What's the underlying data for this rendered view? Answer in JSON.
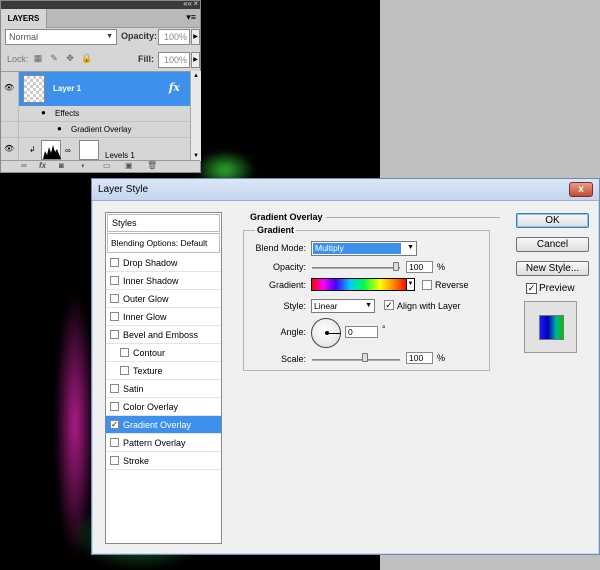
{
  "layers_panel": {
    "tab": "LAYERS",
    "menu_icon": "panel-menu-icon",
    "blend_mode": "Normal",
    "opacity_label": "Opacity:",
    "opacity_value": "100%",
    "lock_label": "Lock:",
    "fill_label": "Fill:",
    "fill_value": "100%",
    "layers": [
      {
        "name": "Layer 1",
        "fx": "fx"
      },
      {
        "name": "Levels 1"
      }
    ],
    "effects_label": "Effects",
    "effect_item": "Gradient Overlay"
  },
  "dialog": {
    "title": "Layer Style",
    "close": "x",
    "styles_header": "Styles",
    "blending_options": "Blending Options: Default",
    "style_items": [
      {
        "label": "Drop Shadow",
        "checked": false
      },
      {
        "label": "Inner Shadow",
        "checked": false
      },
      {
        "label": "Outer Glow",
        "checked": false
      },
      {
        "label": "Inner Glow",
        "checked": false
      },
      {
        "label": "Bevel and Emboss",
        "checked": false
      },
      {
        "label": "Contour",
        "checked": false,
        "indent": true
      },
      {
        "label": "Texture",
        "checked": false,
        "indent": true
      },
      {
        "label": "Satin",
        "checked": false
      },
      {
        "label": "Color Overlay",
        "checked": false
      },
      {
        "label": "Gradient Overlay",
        "checked": true,
        "selected": true
      },
      {
        "label": "Pattern Overlay",
        "checked": false
      },
      {
        "label": "Stroke",
        "checked": false
      }
    ],
    "section_title": "Gradient Overlay",
    "group_title": "Gradient",
    "blend_mode_label": "Blend Mode:",
    "blend_mode_value": "Multiply",
    "opacity_label": "Opacity:",
    "opacity_value": "100",
    "opacity_unit": "%",
    "gradient_label": "Gradient:",
    "reverse_label": "Reverse",
    "style_label": "Style:",
    "style_value": "Linear",
    "align_label": "Align with Layer",
    "align_checked": true,
    "angle_label": "Angle:",
    "angle_value": "0",
    "angle_unit": "°",
    "scale_label": "Scale:",
    "scale_value": "100",
    "scale_unit": "%",
    "ok": "OK",
    "cancel": "Cancel",
    "new_style": "New Style...",
    "preview_label": "Preview",
    "preview_checked": true
  },
  "colors": {
    "selection": "#3d91ed",
    "canvas": "#000000"
  }
}
